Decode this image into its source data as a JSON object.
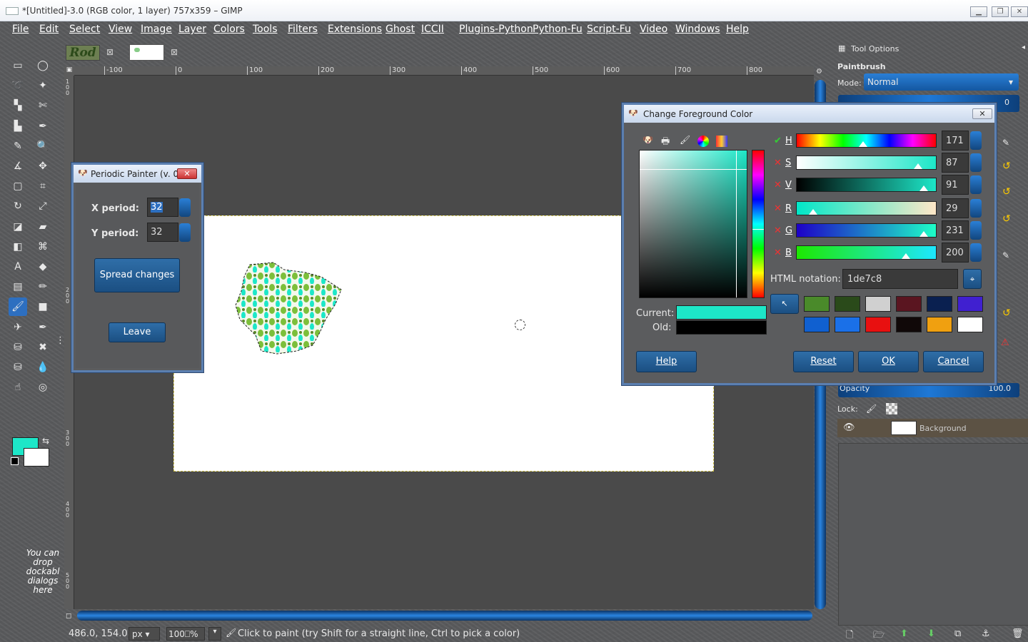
{
  "window": {
    "title": "*[Untitled]-3.0 (RGB color, 1 layer) 757x359 – GIMP",
    "min": "▁",
    "max": "❐",
    "close": "✕"
  },
  "menu": [
    "File",
    "Edit",
    "Select",
    "View",
    "Image",
    "Layer",
    "Colors",
    "Tools",
    "Filters",
    "Extensions",
    "Ghost",
    "ICCII",
    "Plugins-Python",
    "Python-Fu",
    "Script-Fu",
    "Video",
    "Windows",
    "Help"
  ],
  "image_tabs": {
    "first": "Rod"
  },
  "toolbox": {
    "dock_hint": "You can drop dockabl dialogs here",
    "fg_color": "#1de7c8",
    "bg_color": "#ffffff"
  },
  "rulers": {
    "top": [
      "-100",
      "0",
      "100",
      "200",
      "300",
      "400",
      "500",
      "600",
      "700",
      "800"
    ],
    "left": [
      "1 0 0",
      "2 0 0",
      "3 0 0",
      "4 0 0",
      "5 0 0"
    ]
  },
  "status": {
    "coords": "486.0, 154.0",
    "unit": "px",
    "zoom": "100",
    "zoom_unit": "%",
    "message": "Click to paint (try Shift for a straight line, Ctrl to pick a color)"
  },
  "periodic": {
    "title": "Periodic Painter (v. 0...",
    "x_label": "X period:",
    "x_value": "32",
    "y_label": "Y period:",
    "y_value": "32",
    "spread": "Spread changes",
    "leave": "Leave"
  },
  "fg_dialog": {
    "title": "Change Foreground Color",
    "channels": [
      {
        "label": "H",
        "value": "171",
        "pos": 0.47,
        "ok": true
      },
      {
        "label": "S",
        "value": "87",
        "pos": 0.87,
        "ok": false
      },
      {
        "label": "V",
        "value": "91",
        "pos": 0.91,
        "ok": false
      },
      {
        "label": "R",
        "value": "29",
        "pos": 0.11,
        "ok": false
      },
      {
        "label": "G",
        "value": "231",
        "pos": 0.91,
        "ok": false
      },
      {
        "label": "B",
        "value": "200",
        "pos": 0.78,
        "ok": false
      }
    ],
    "html_label": "HTML notation:",
    "html_value": "1de7c8",
    "current_label": "Current:",
    "old_label": "Old:",
    "current_color": "#1de7c8",
    "old_color": "#000000",
    "history": [
      "#4a8a2a",
      "#2a4a1a",
      "#d0d0d0",
      "#5a1520",
      "#0a2050",
      "#4020d0",
      "#1060d0",
      "#1a70e8",
      "#e81010",
      "#100808",
      "#f0a010",
      "#ffffff"
    ],
    "help": "Help",
    "reset": "Reset",
    "ok": "OK",
    "cancel": "Cancel"
  },
  "dock": {
    "tool_options": "Tool Options",
    "tool_name": "Paintbrush",
    "mode_label": "Mode:",
    "mode_value": "Normal",
    "size_value": "0",
    "opacity_label": "Opacity",
    "opacity_value": "100.0",
    "lock_label": "Lock:",
    "layer_name": "Background"
  }
}
